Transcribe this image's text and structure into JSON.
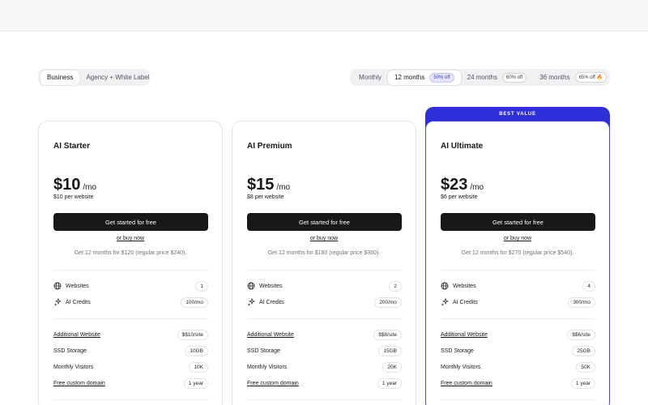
{
  "plan_tabs": [
    {
      "label": "Business",
      "active": true
    },
    {
      "label": "Agency + White Label",
      "active": false
    }
  ],
  "term_tabs": [
    {
      "label": "Monthly",
      "badge": "",
      "active": false
    },
    {
      "label": "12 months",
      "badge": "50% off",
      "active": true
    },
    {
      "label": "24 months",
      "badge": "60% off",
      "active": false
    },
    {
      "label": "36 months",
      "badge": "65% off 🔥",
      "active": false
    }
  ],
  "ribbon": "BEST VALUE",
  "colors": {
    "accent": "#2f2fd8",
    "cta": "#18181b"
  },
  "plans": [
    {
      "name": "AI Starter",
      "price": "$10",
      "per": "/mo",
      "sub": "$10 per website",
      "cta": "Get started for free",
      "buy": "or buy now",
      "note": "Get 12 months for $120 (regular price $240).",
      "websites_label": "Websites",
      "websites": "1",
      "credits_label": "AI Credits",
      "credits": "100/mo",
      "additional_label": "Additional Website",
      "additional": "$$10/site",
      "ssd_label": "SSD Storage",
      "ssd": "10GB",
      "visitors_label": "Monthly Visitors",
      "visitors": "10K",
      "domain_label": "Free custom domain",
      "domain": "1 year"
    },
    {
      "name": "AI Premium",
      "price": "$15",
      "per": "/mo",
      "sub": "$8 per website",
      "cta": "Get started for free",
      "buy": "or buy now",
      "note": "Get 12 months for $180 (regular price $360).",
      "websites_label": "Websites",
      "websites": "2",
      "credits_label": "AI Credits",
      "credits": "200/mo",
      "additional_label": "Additional Website",
      "additional": "$$8/site",
      "ssd_label": "SSD Storage",
      "ssd": "15GB",
      "visitors_label": "Monthly Visitors",
      "visitors": "20K",
      "domain_label": "Free custom domain",
      "domain": "1 year"
    },
    {
      "name": "AI Ultimate",
      "price": "$23",
      "per": "/mo",
      "sub": "$6 per website",
      "cta": "Get started for free",
      "buy": "or buy now",
      "note": "Get 12 months for $270 (regular price $540).",
      "websites_label": "Websites",
      "websites": "4",
      "credits_label": "AI Credits",
      "credits": "300/mo",
      "additional_label": "Additional Website",
      "additional": "$$6/site",
      "ssd_label": "SSD Storage",
      "ssd": "25GB",
      "visitors_label": "Monthly Visitors",
      "visitors": "50K",
      "domain_label": "Free custom domain",
      "domain": "1 year"
    }
  ]
}
